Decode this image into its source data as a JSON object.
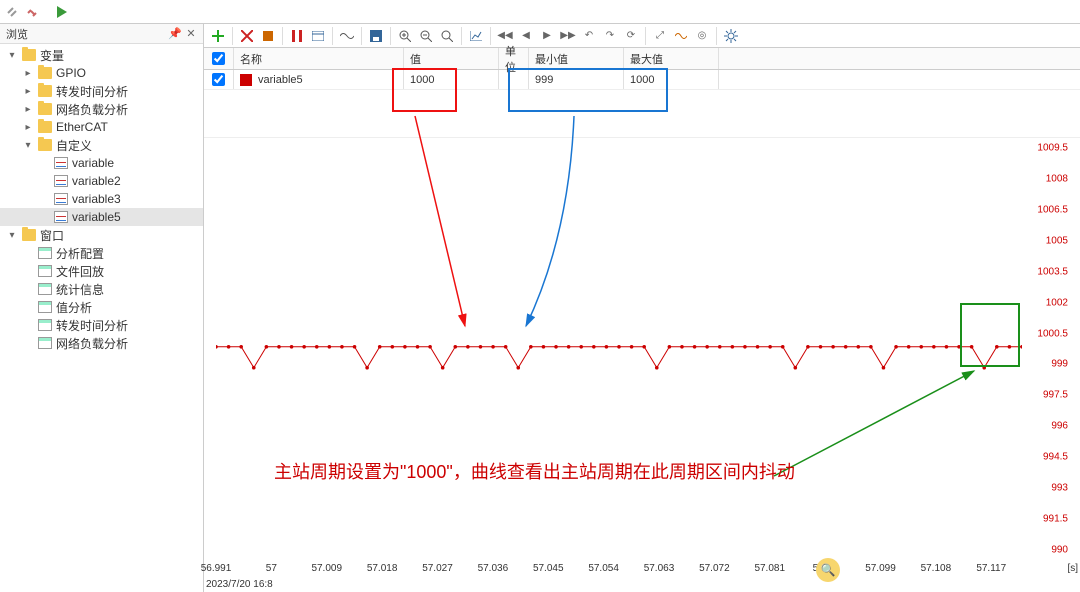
{
  "top_tb_icons": [
    "link-icon",
    "disconnect-icon",
    "play-icon"
  ],
  "sidebar": {
    "title": "浏览",
    "sections": [
      {
        "label": "变量",
        "expanded": true,
        "icon": "folder",
        "children": [
          {
            "label": "GPIO",
            "icon": "folder",
            "expandable": true
          },
          {
            "label": "转发时间分析",
            "icon": "folder",
            "expandable": true
          },
          {
            "label": "网络负载分析",
            "icon": "folder",
            "expandable": true
          },
          {
            "label": "EtherCAT",
            "icon": "folder",
            "expandable": true
          },
          {
            "label": "自定义",
            "icon": "folder",
            "expanded": true,
            "expandable": true,
            "children": [
              {
                "label": "variable",
                "icon": "var"
              },
              {
                "label": "variable2",
                "icon": "var"
              },
              {
                "label": "variable3",
                "icon": "var"
              },
              {
                "label": "variable5",
                "icon": "var",
                "selected": true
              }
            ]
          }
        ]
      },
      {
        "label": "窗口",
        "expanded": true,
        "icon": "folder",
        "children": [
          {
            "label": "分析配置",
            "icon": "win"
          },
          {
            "label": "文件回放",
            "icon": "win"
          },
          {
            "label": "统计信息",
            "icon": "win"
          },
          {
            "label": "值分析",
            "icon": "win"
          },
          {
            "label": "转发时间分析",
            "icon": "win"
          },
          {
            "label": "网络负载分析",
            "icon": "win"
          }
        ]
      }
    ]
  },
  "content_tb_icons": [
    "add-icon",
    "",
    "delete-icon",
    "stop-icon",
    "",
    "pause-icon",
    "window-icon",
    "",
    "wave-icon",
    "",
    "save-icon",
    "",
    "zoom-in-icon",
    "zoom-out-icon",
    "zoom-reset-icon",
    "",
    "chart-icon",
    "",
    "nav-first-icon",
    "nav-prev-icon",
    "nav-next-icon",
    "nav-last-icon",
    "undo-icon",
    "redo-icon",
    "refresh-icon",
    "",
    "fit-icon",
    "chart2-icon",
    "target-icon",
    "",
    "settings-icon"
  ],
  "grid": {
    "headers": {
      "check": "",
      "name": "名称",
      "value": "值",
      "unit": "单位",
      "min": "最小值",
      "max": "最大值"
    },
    "rows": [
      {
        "checked": true,
        "color": "#c00",
        "name": "variable5",
        "value": "1000",
        "unit": "",
        "min": "999",
        "max": "1000"
      }
    ]
  },
  "chart_data": {
    "type": "line",
    "title": "",
    "ylabel": "variable5",
    "xlabel": "[s]",
    "ylim": [
      990,
      1009.5
    ],
    "xlim": [
      56.991,
      57.122
    ],
    "yticks": [
      1009.5,
      1008,
      1006.5,
      1005,
      1003.5,
      1002,
      1000.5,
      999,
      997.5,
      996,
      994.5,
      993,
      991.5,
      990
    ],
    "xticks": [
      56.991,
      57,
      57.009,
      57.018,
      57.027,
      57.036,
      57.045,
      57.054,
      57.063,
      57.072,
      57.081,
      57.09,
      57.099,
      57.108,
      57.117
    ],
    "series": [
      {
        "name": "variable5",
        "color": "#c00",
        "values": [
          1000,
          1000,
          1000,
          999,
          1000,
          1000,
          1000,
          1000,
          1000,
          1000,
          1000,
          1000,
          999,
          1000,
          1000,
          1000,
          1000,
          1000,
          999,
          1000,
          1000,
          1000,
          1000,
          1000,
          999,
          1000,
          1000,
          1000,
          1000,
          1000,
          1000,
          1000,
          1000,
          1000,
          1000,
          999,
          1000,
          1000,
          1000,
          1000,
          1000,
          1000,
          1000,
          1000,
          1000,
          1000,
          999,
          1000,
          1000,
          1000,
          1000,
          1000,
          1000,
          999,
          1000,
          1000,
          1000,
          1000,
          1000,
          1000,
          1000,
          999,
          1000,
          1000,
          1000
        ]
      }
    ],
    "timestamp": "2023/7/20 16:8",
    "annotation": "主站周期设置为\"1000\"，曲线查看出主站周期在此周期区间内抖动"
  },
  "colors": {
    "accent_red": "#c00",
    "accent_blue": "#1976d2",
    "accent_green": "#1a8f1a"
  }
}
